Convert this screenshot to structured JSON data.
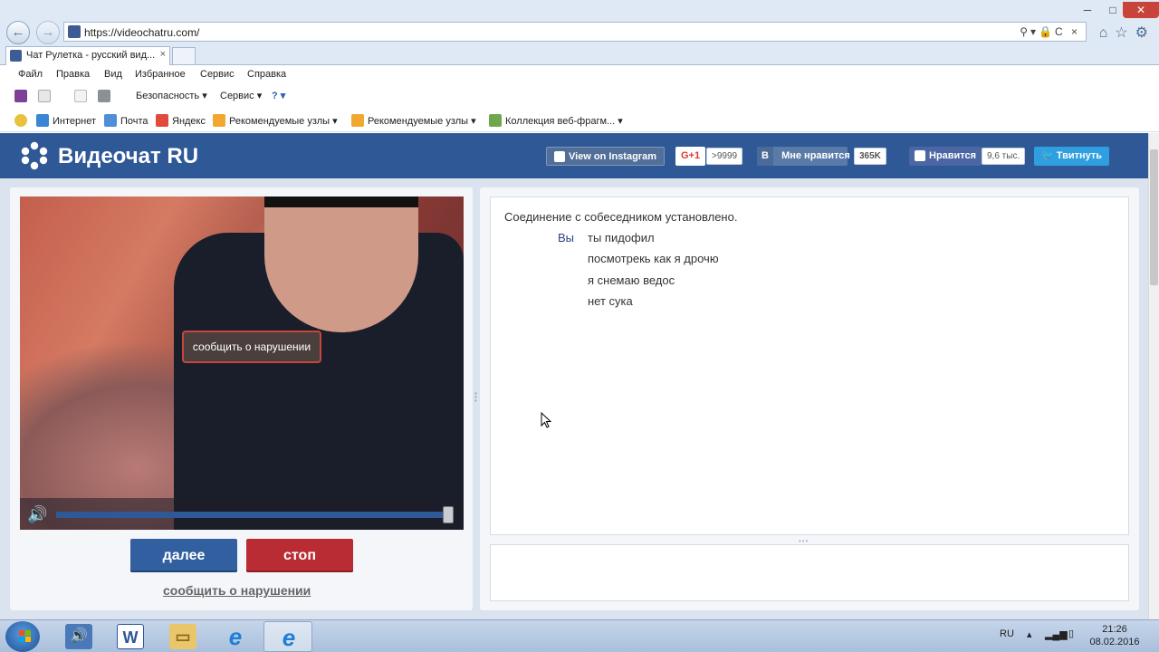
{
  "browser": {
    "url": "https://videochatru.com/",
    "tab_title": "Чат Рулетка - русский вид...",
    "tab_close": "×",
    "back_glyph": "←",
    "forward_glyph": "→",
    "addr_tools": "⚲▾🔒C ×",
    "window_controls": {
      "minimize": "─",
      "maximize": "□",
      "close": "✕"
    },
    "right_icons": "⌂☆⚙",
    "menu": [
      "Файл",
      "Правка",
      "Вид",
      "Избранное",
      "Сервис",
      "Справка"
    ],
    "command_bar": {
      "safety": "Безопасность ▾",
      "tools": "Сервис ▾",
      "help": "? ▾"
    },
    "favorites": [
      {
        "label": "Интернет",
        "icon": "ie-icon"
      },
      {
        "label": "Почта",
        "icon": "mail-icon"
      },
      {
        "label": "Яндекс",
        "icon": "yandex-icon"
      },
      {
        "label": "Рекомендуемые узлы ▾",
        "icon": "bing-icon"
      },
      {
        "label": "Рекомендуемые узлы ▾",
        "icon": "bing-icon"
      },
      {
        "label": "Коллекция веб-фрагм... ▾",
        "icon": "webslice-icon"
      }
    ]
  },
  "site": {
    "logo": "Видеочат RU",
    "instagram": "View on Instagram",
    "gplus": "G+1",
    "gplus_count": ">9999",
    "vk_label": "B",
    "vk_like": "Мне нравится",
    "vk_count": "365K",
    "fb_like": "Нравится",
    "fb_count": "9,6 тыс.",
    "tweet": "Твитнуть"
  },
  "video": {
    "report_bubble": "сообщить о нарушении",
    "volume_icon": "🔊",
    "volume_level": 1.0
  },
  "controls": {
    "next": "далее",
    "stop": "стоп",
    "report": "сообщить о нарушении"
  },
  "chat": {
    "system": "Соединение с собеседником установлено.",
    "you_label": "Вы",
    "messages": [
      "ты пидофил",
      "посмотрекь как я дрочю",
      "я снемаю ведос",
      "нет сука"
    ]
  },
  "taskbar": {
    "language": "RU",
    "time": "21:26",
    "date": "08.02.2016",
    "apps": [
      {
        "name": "speaker",
        "glyph": "🔊"
      },
      {
        "name": "word",
        "glyph": "W"
      },
      {
        "name": "explorer",
        "glyph": "▭"
      },
      {
        "name": "ie",
        "glyph": "e"
      },
      {
        "name": "ie-active",
        "glyph": "e"
      }
    ]
  },
  "colors": {
    "header_blue": "#2f5896",
    "next_blue": "#315f9f",
    "stop_red": "#b92c33",
    "you_color": "#2c3f8a"
  }
}
